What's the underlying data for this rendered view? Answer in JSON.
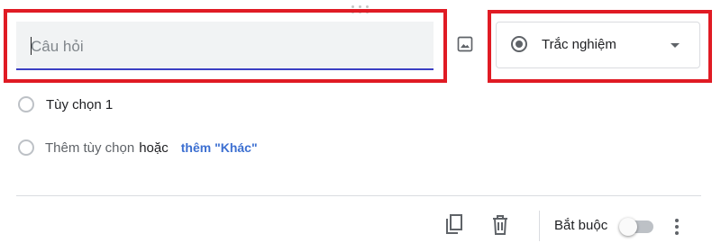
{
  "question": {
    "placeholder": "Câu hỏi",
    "value": ""
  },
  "question_type": {
    "selected": "Trắc nghiệm",
    "icon": "radio-button-checked-icon"
  },
  "options": [
    {
      "label": "Tùy chọn 1"
    }
  ],
  "add_option": {
    "add_label": "Thêm tùy chọn",
    "or_label": "hoặc",
    "add_other_label": "thêm \"Khác\""
  },
  "footer": {
    "required_label": "Bắt buộc",
    "required_on": false
  },
  "colors": {
    "highlight": "#e01b24",
    "underline": "#3c3fc4",
    "link": "#3c6fd1"
  }
}
